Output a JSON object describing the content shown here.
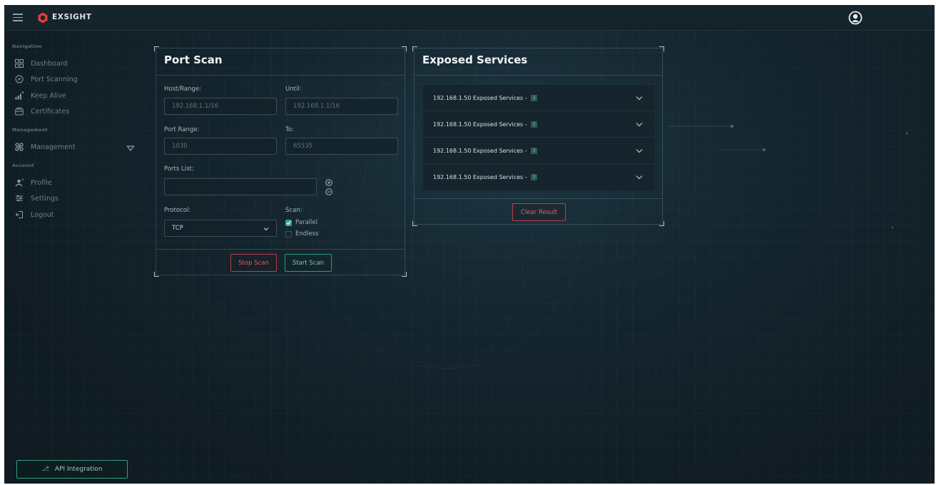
{
  "app": {
    "brand": "EXSIGHT"
  },
  "sidebar": {
    "sections": [
      {
        "label": "Navigation"
      },
      {
        "label": "Management"
      },
      {
        "label": "Account"
      }
    ],
    "items": [
      {
        "label": "Dashboard",
        "icon": "dashboard-icon"
      },
      {
        "label": "Port Scanning",
        "icon": "compass-icon"
      },
      {
        "label": "Keep Alive",
        "icon": "signal-icon"
      },
      {
        "label": "Certificates",
        "icon": "certificate-icon"
      },
      {
        "label": "Management",
        "icon": "management-icon"
      },
      {
        "label": "Profile",
        "icon": "profile-icon"
      },
      {
        "label": "Settings",
        "icon": "settings-icon"
      },
      {
        "label": "Logout",
        "icon": "logout-icon"
      }
    ],
    "api_button": "API Integration"
  },
  "port_scan": {
    "title": "Port Scan",
    "host_label": "Host/Range:",
    "host_value": "192.168.1.1/16",
    "until_label": "Until:",
    "until_value": "192.168.1.1/16",
    "port_range_label": "Port Range:",
    "port_range_value": "1030",
    "to_label": "To:",
    "to_value": "65535",
    "ports_list_label": "Ports List:",
    "ports_list_value": "",
    "protocol_label": "Protocol:",
    "protocol_value": "TCP",
    "scan_label": "Scan:",
    "parallel_label": "Parallel",
    "parallel_checked": true,
    "endless_label": "Endless",
    "endless_checked": false,
    "stop_button": "Stop Scan",
    "start_button": "Start Scan"
  },
  "exposed_services": {
    "title": "Exposed Services",
    "rows": [
      {
        "label": "192.168.1.50 Exposed Services -",
        "count": "3"
      },
      {
        "label": "192.168.1.50 Exposed Services -",
        "count": "3"
      },
      {
        "label": "192.168.1.50 Exposed Services -",
        "count": "3"
      },
      {
        "label": "192.168.1.50 Exposed Services -",
        "count": "3"
      }
    ],
    "clear_button": "Clear Result"
  },
  "colors": {
    "accent_green": "#2fa07f",
    "danger_red": "#b8404a",
    "brand_red": "#e23b3b",
    "background": "#142530"
  }
}
